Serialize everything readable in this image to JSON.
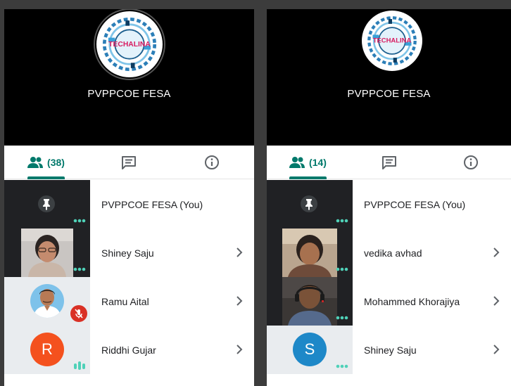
{
  "left_panel": {
    "meeting_name": "PVPPCOE FESA",
    "logo_text": "TECHALINA",
    "tabs": {
      "people_count": "(38)"
    },
    "participants": [
      {
        "name": "PVPPCOE FESA (You)",
        "tile": "pinned-self",
        "indicator": "dots"
      },
      {
        "name": "Shiney Saju",
        "tile": "video",
        "indicator": "dots"
      },
      {
        "name": "Ramu Aital",
        "tile": "photo-avatar",
        "indicator": "muted"
      },
      {
        "name": "Riddhi Gujar",
        "tile": "letter-avatar",
        "letter": "R",
        "indicator": "speaking"
      }
    ]
  },
  "right_panel": {
    "meeting_name": "PVPPCOE FESA",
    "logo_text": "TECHALINA",
    "tabs": {
      "people_count": "(14)"
    },
    "participants": [
      {
        "name": "PVPPCOE FESA (You)",
        "tile": "pinned-self",
        "indicator": "dots"
      },
      {
        "name": "vedika avhad",
        "tile": "video",
        "indicator": "dots"
      },
      {
        "name": "Mohammed Khorajiya",
        "tile": "video",
        "indicator": "dots"
      },
      {
        "name": "Shiney Saju",
        "tile": "letter-avatar",
        "letter": "S",
        "indicator": "dots"
      }
    ]
  },
  "colors": {
    "accent": "#00796b",
    "indicator_dots": "#4fd1b8",
    "avatar_r": "#f4511e",
    "avatar_s": "#1e88c8",
    "mute_red": "#d93025"
  }
}
